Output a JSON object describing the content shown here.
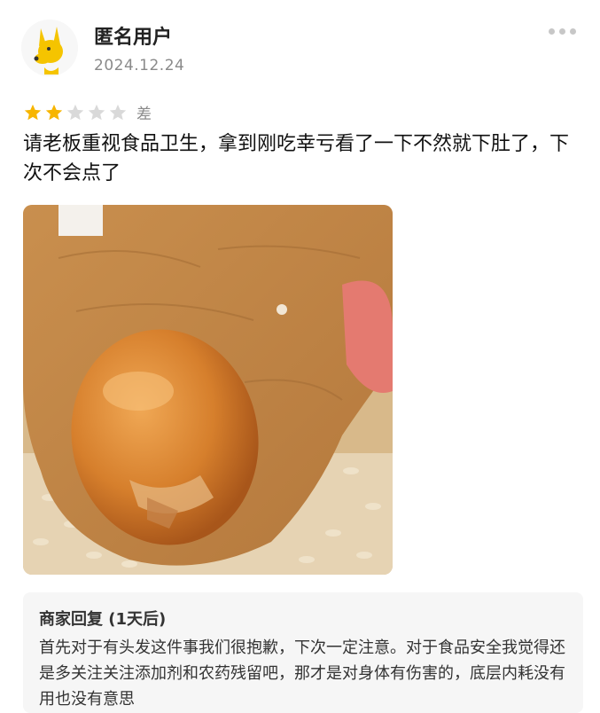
{
  "review": {
    "username": "匿名用户",
    "date": "2024.12.24",
    "rating": 2,
    "rating_max": 5,
    "rating_label": "差",
    "text": "请老板重视食品卫生，拿到刚吃幸亏看了一下不然就下肚了，下次不会点了"
  },
  "merchant_reply": {
    "title": "商家回复 (1天后)",
    "text": "首先对于有头发这件事我们很抱歉，下次一定注意。对于食品安全我觉得还是多关注关注添加剂和农药残留吧，那才是对身体有伤害的，底层内耗没有用也没有意思"
  },
  "colors": {
    "star_filled": "#f7b500",
    "star_empty": "#d9d9d9",
    "reply_bg": "#f6f6f6",
    "avatar_dog": "#f5c400"
  },
  "icons": {
    "avatar": "yellow-dog-avatar",
    "more": "more-dots-icon",
    "star": "star-icon"
  }
}
